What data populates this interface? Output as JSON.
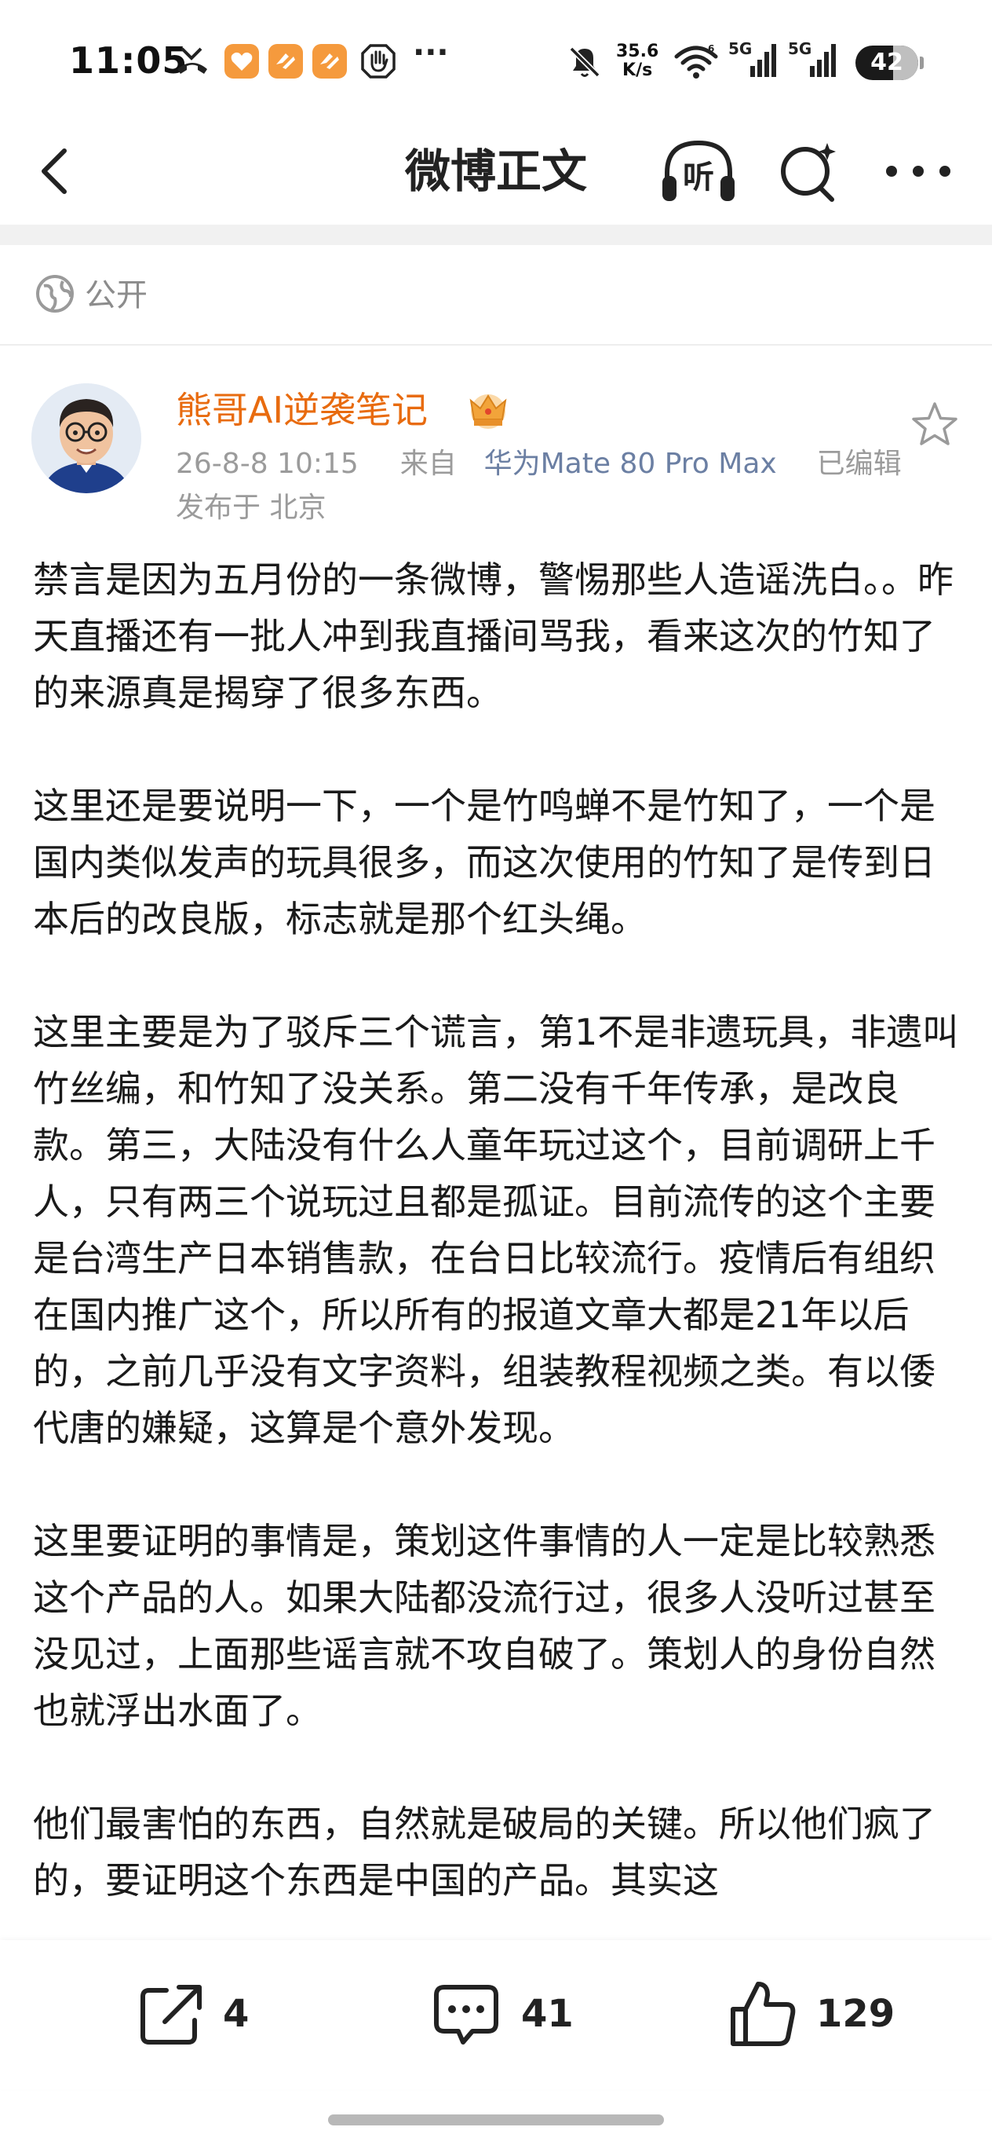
{
  "status_bar": {
    "time": "11:05",
    "net_speed_value": "35.6",
    "net_speed_unit": "K/s",
    "signal_1": "5G",
    "signal_2": "5G",
    "battery": "42",
    "more_indicator": "···"
  },
  "nav": {
    "title": "微博正文",
    "listen_label": "听"
  },
  "visibility": {
    "label": "公开"
  },
  "author": {
    "name": "熊哥AI逆袭笔记",
    "date": "26-8-8 10:15",
    "source_prefix": "来自",
    "device": "华为Mate 80 Pro Max",
    "edited": "已编辑",
    "location": "发布于 北京"
  },
  "post": {
    "paragraphs": [
      "禁言是因为五月份的一条微博，警惕那些人造谣洗白。。昨天直播还有一批人冲到我直播间骂我，看来这次的竹知了的来源真是揭穿了很多东西。",
      "这里还是要说明一下，一个是竹鸣蝉不是竹知了，一个是国内类似发声的玩具很多，而这次使用的竹知了是传到日本后的改良版，标志就是那个红头绳。",
      "这里主要是为了驳斥三个谎言，第1不是非遗玩具，非遗叫竹丝编，和竹知了没关系。第二没有千年传承，是改良款。第三，大陆没有什么人童年玩过这个，目前调研上千人，只有两三个说玩过且都是孤证。目前流传的这个主要是台湾生产日本销售款，在台日比较流行。疫情后有组织在国内推广这个，所以所有的报道文章大都是21年以后的，之前几乎没有文字资料，组装教程视频之类。有以倭代唐的嫌疑，这算是个意外发现。",
      "这里要证明的事情是，策划这件事情的人一定是比较熟悉这个产品的人。如果大陆都没流行过，很多人没听过甚至没见过，上面那些谣言就不攻自破了。策划人的身份自然也就浮出水面了。",
      "他们最害怕的东西，自然就是破局的关键。所以他们疯了的，要证明这个东西是中国的产品。其实这"
    ]
  },
  "actions": {
    "repost_count": "4",
    "comment_count": "41",
    "like_count": "129"
  },
  "colors": {
    "author_name": "#e86b0f",
    "meta_text": "#9b9b9b",
    "device_link": "#6b7fa3",
    "badge_orange": "#f59a3d"
  }
}
